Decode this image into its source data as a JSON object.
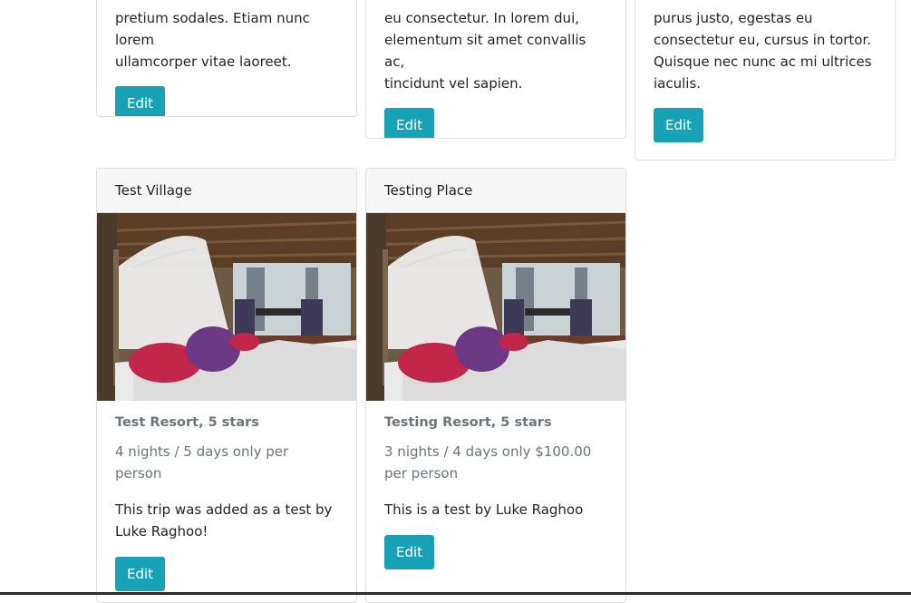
{
  "top_cards": [
    {
      "text": [
        "pretium sodales. Etiam nunc lorem",
        "ullamcorper vitae laoreet."
      ],
      "button": "Edit"
    },
    {
      "text": [
        "eu consectetur. In lorem dui,",
        "elementum sit amet convallis ac,",
        "tincidunt vel sapien."
      ],
      "button": "Edit"
    },
    {
      "text": [
        "purus justo, egestas eu",
        "consectetur eu, cursus in tortor.",
        "Quisque nec nunc ac mi ultrices",
        "iaculis."
      ],
      "button": "Edit"
    }
  ],
  "cards": [
    {
      "header": "Test Village",
      "image": "resort-bedroom-photo",
      "title": "Test Resort, 5 stars",
      "price": "4 nights / 5 days only per person",
      "description": "This trip was added as a test by Luke Raghoo!",
      "button": "Edit"
    },
    {
      "header": "Testing Place",
      "image": "resort-bedroom-photo",
      "title": "Testing Resort, 5 stars",
      "price": "3 nights / 4 days only $100.00 per person",
      "description": "This is a test by Luke Raghoo",
      "button": "Edit"
    }
  ],
  "colors": {
    "button_bg": "#17a2b8",
    "muted_text": "#6c757d",
    "header_bg": "#f7f7f7"
  }
}
